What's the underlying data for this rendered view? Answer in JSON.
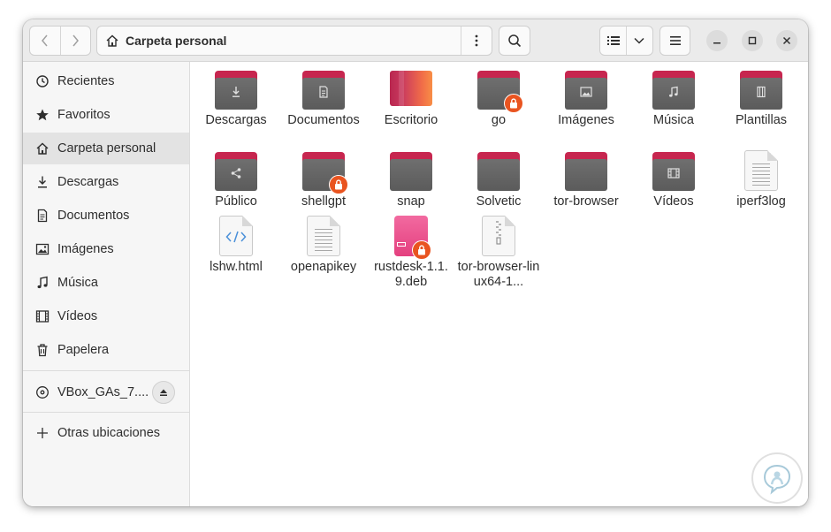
{
  "header": {
    "path_title": "Carpeta personal"
  },
  "sidebar": {
    "items": [
      {
        "label": "Recientes",
        "icon": "clock-icon"
      },
      {
        "label": "Favoritos",
        "icon": "star-icon"
      },
      {
        "label": "Carpeta personal",
        "icon": "home-icon",
        "active": true
      },
      {
        "label": "Descargas",
        "icon": "download-icon"
      },
      {
        "label": "Documentos",
        "icon": "document-icon"
      },
      {
        "label": "Imágenes",
        "icon": "image-icon"
      },
      {
        "label": "Música",
        "icon": "music-icon"
      },
      {
        "label": "Vídeos",
        "icon": "film-icon"
      },
      {
        "label": "Papelera",
        "icon": "trash-icon"
      }
    ],
    "device": {
      "label": "VBox_GAs_7....",
      "icon": "disc-icon"
    },
    "other": {
      "label": "Otras ubicaciones",
      "icon": "plus-icon"
    }
  },
  "files": [
    {
      "label": "Descargas",
      "kind": "folder",
      "emblem": "download"
    },
    {
      "label": "Documentos",
      "kind": "folder",
      "emblem": "document"
    },
    {
      "label": "Escritorio",
      "kind": "desktop"
    },
    {
      "label": "go",
      "kind": "folder",
      "locked": true
    },
    {
      "label": "Imágenes",
      "kind": "folder",
      "emblem": "image"
    },
    {
      "label": "Música",
      "kind": "folder",
      "emblem": "music"
    },
    {
      "label": "Plantillas",
      "kind": "folder",
      "emblem": "template"
    },
    {
      "label": "Público",
      "kind": "folder",
      "emblem": "share"
    },
    {
      "label": "shellgpt",
      "kind": "folder",
      "locked": true
    },
    {
      "label": "snap",
      "kind": "folder"
    },
    {
      "label": "Solvetic",
      "kind": "folder"
    },
    {
      "label": "tor-browser",
      "kind": "folder"
    },
    {
      "label": "Vídeos",
      "kind": "folder",
      "emblem": "film"
    },
    {
      "label": "iperf3log",
      "kind": "text"
    },
    {
      "label": "lshw.html",
      "kind": "html"
    },
    {
      "label": "openapikey",
      "kind": "text"
    },
    {
      "label": "rustdesk-1.1.9.deb",
      "kind": "deb",
      "locked": true
    },
    {
      "label": "tor-browser-linux64-1...",
      "kind": "archive"
    }
  ]
}
